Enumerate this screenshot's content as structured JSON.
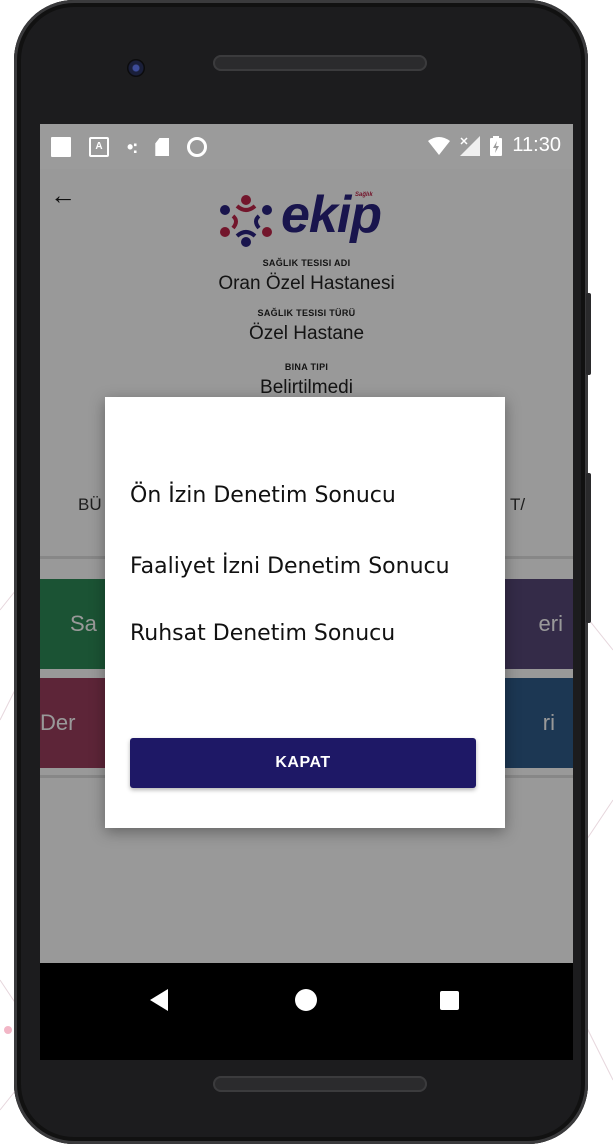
{
  "status_bar": {
    "time": "11:30",
    "left_icons": [
      "square-icon",
      "a-box-icon",
      "dots-icon",
      "sd-card-icon",
      "circle-icon"
    ],
    "right_icons": [
      "wifi-icon",
      "no-signal-icon",
      "battery-charging-icon"
    ]
  },
  "header": {
    "logo_text": "ekip",
    "logo_small": "Sağlık"
  },
  "facility": {
    "name_label": "SAĞLIK TESISI ADI",
    "name_value": "Oran Özel Hastanesi",
    "type_label": "SAĞLIK TESISI TÜRÜ",
    "type_value": "Özel Hastane",
    "building_label": "BINA TIPI",
    "building_value": "Belirtilmedi"
  },
  "background_fragments": {
    "left_row": "BÜ",
    "right_row": "T/",
    "tile1_left": "Sa",
    "tile1_right": "eri",
    "tile2_left": "Der",
    "tile2_right": "ri"
  },
  "colors": {
    "tile_green": "#2e8b57",
    "tile_purple": "#574979",
    "tile_pink": "#9b3f5e",
    "tile_blue": "#2f5d8a",
    "button_primary": "#1e1866"
  },
  "dialog": {
    "items": [
      "Ön İzin Denetim Sonucu",
      "Faaliyet İzni Denetim Sonucu",
      "Ruhsat Denetim Sonucu"
    ],
    "close_label": "KAPAT"
  }
}
